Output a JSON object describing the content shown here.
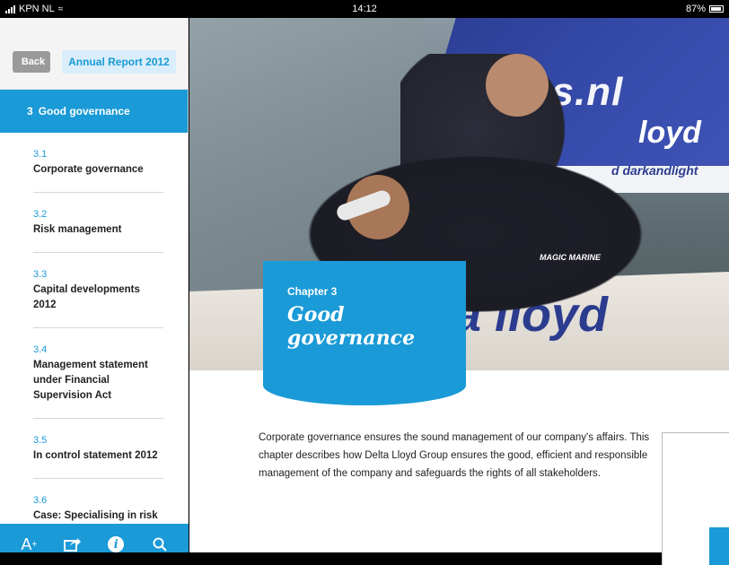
{
  "status_bar": {
    "carrier": "KPN NL",
    "time": "14:12",
    "battery": "87%"
  },
  "sidebar": {
    "back_label": "Back",
    "report_label": "Annual Report 2012",
    "current_chapter": {
      "number": "3",
      "title": "Good governance"
    },
    "items": [
      {
        "number": "3.1",
        "title": "Corporate governance"
      },
      {
        "number": "3.2",
        "title": "Risk management"
      },
      {
        "number": "3.3",
        "title": "Capital developments 2012"
      },
      {
        "number": "3.4",
        "title": "Management statement under Financial Supervision Act"
      },
      {
        "number": "3.5",
        "title": "In control statement 2012"
      },
      {
        "number": "3.6",
        "title": "Case: Specialising in risk"
      }
    ],
    "toolbar": {
      "font_size_label": "A",
      "font_size_sup": "+",
      "share_icon": "share-icon",
      "info_icon": "info-icon",
      "search_icon": "search-icon"
    }
  },
  "hero": {
    "sail_text": "Le  press.nl",
    "sail_text2": "loyd",
    "sail_text3": "d  darkandlight",
    "hull_text": "lta lloyd",
    "brand": "MAGIC MARINE"
  },
  "chapter_card": {
    "label": "Chapter 3",
    "title": "Good governance"
  },
  "intro_text": "Corporate governance ensures the sound management of our company's affairs. This chapter describes how Delta Lloyd Group ensures the good, efficient and responsible management of the company and safeguards the rights of all stakeholders.",
  "colors": {
    "accent": "#1a9ad6",
    "accent_light": "#d9eefa",
    "back_button": "#9a9a9a"
  }
}
